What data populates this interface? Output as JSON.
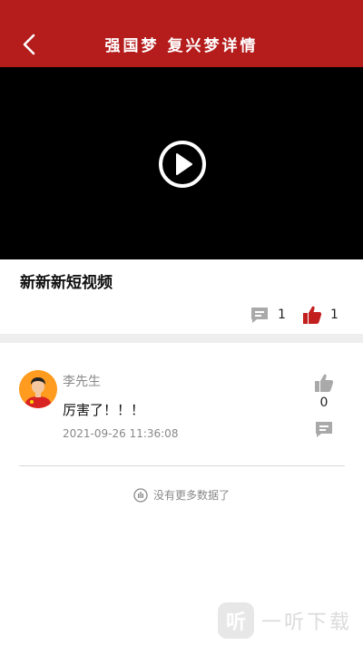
{
  "header": {
    "title": "强国梦 复兴梦详情"
  },
  "video": {
    "title": "新新新短视频",
    "comment_count": "1",
    "like_count": "1"
  },
  "comments": [
    {
      "author": "李先生",
      "text": "厉害了！！！",
      "time": "2021-09-26 11:36:08",
      "likes": "0"
    }
  ],
  "footer": {
    "no_more": "没有更多数据了"
  },
  "watermark": {
    "icon_char": "听",
    "text": "一听下载"
  },
  "colors": {
    "brand_red": "#b51c1c",
    "like_red": "#c41f1f",
    "icon_gray": "#a9a9a9"
  }
}
